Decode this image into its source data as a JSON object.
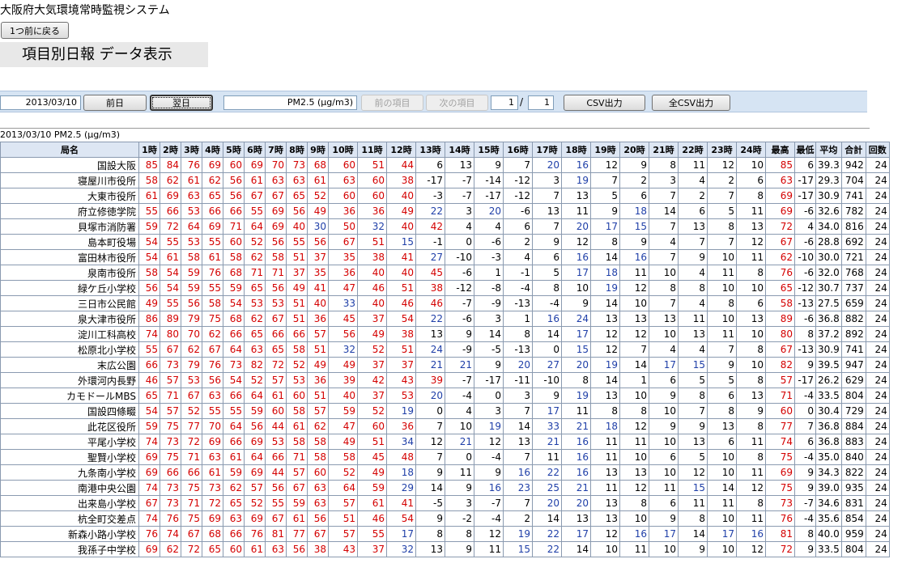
{
  "system_title": "大阪府大気環境常時監視システム",
  "back_button": "1つ前に戻る",
  "page_heading": "項目別日報 データ表示",
  "toolbar": {
    "date": "2013/03/10",
    "prev_day": "前日",
    "next_day": "翌日",
    "item": "PM2.5 (μg/m3)",
    "prev_item": "前の項目",
    "next_item": "次の項目",
    "page_current": "1",
    "page_sep": "/",
    "page_total": "1",
    "csv": "CSV出力",
    "csv_all": "全CSV出力"
  },
  "table": {
    "caption": "2013/03/10  PM2.5 (μg/m3)",
    "headers": [
      "局名",
      "1時",
      "2時",
      "3時",
      "4時",
      "5時",
      "6時",
      "7時",
      "8時",
      "9時",
      "10時",
      "11時",
      "12時",
      "13時",
      "14時",
      "15時",
      "16時",
      "17時",
      "18時",
      "19時",
      "20時",
      "21時",
      "22時",
      "23時",
      "24時",
      "最高",
      "最低",
      "平均",
      "合計",
      "回数"
    ],
    "rows": [
      [
        "国設大阪",
        "85",
        "84",
        "76",
        "69",
        "60",
        "69",
        "70",
        "73",
        "68",
        "60",
        "51",
        "44",
        "6",
        "13",
        "9",
        "7",
        "20",
        "16",
        "12",
        "9",
        "8",
        "11",
        "12",
        "10",
        "85",
        "6",
        "39.3",
        "942",
        "24"
      ],
      [
        "寝屋川市役所",
        "58",
        "62",
        "61",
        "62",
        "56",
        "61",
        "63",
        "63",
        "61",
        "63",
        "60",
        "38",
        "-17",
        "-7",
        "-14",
        "-12",
        "3",
        "19",
        "7",
        "2",
        "3",
        "4",
        "2",
        "6",
        "63",
        "-17",
        "29.3",
        "704",
        "24"
      ],
      [
        "大東市役所",
        "61",
        "69",
        "63",
        "65",
        "56",
        "67",
        "67",
        "65",
        "52",
        "60",
        "60",
        "40",
        "-3",
        "-7",
        "-17",
        "-12",
        "7",
        "13",
        "5",
        "6",
        "7",
        "2",
        "7",
        "8",
        "69",
        "-17",
        "30.9",
        "741",
        "24"
      ],
      [
        "府立修徳学院",
        "55",
        "66",
        "53",
        "66",
        "66",
        "55",
        "69",
        "56",
        "49",
        "36",
        "36",
        "49",
        "22",
        "3",
        "20",
        "-6",
        "13",
        "11",
        "9",
        "18",
        "14",
        "6",
        "5",
        "11",
        "69",
        "-6",
        "32.6",
        "782",
        "24"
      ],
      [
        "貝塚市消防署",
        "59",
        "72",
        "64",
        "69",
        "71",
        "64",
        "69",
        "40",
        "30",
        "50",
        "32",
        "40",
        "42",
        "4",
        "4",
        "6",
        "7",
        "20",
        "17",
        "15",
        "7",
        "13",
        "8",
        "13",
        "72",
        "4",
        "34.0",
        "816",
        "24"
      ],
      [
        "島本町役場",
        "54",
        "55",
        "53",
        "55",
        "60",
        "52",
        "56",
        "55",
        "56",
        "67",
        "51",
        "15",
        "-1",
        "0",
        "-6",
        "2",
        "9",
        "12",
        "8",
        "9",
        "4",
        "7",
        "7",
        "12",
        "67",
        "-6",
        "28.8",
        "692",
        "24"
      ],
      [
        "富田林市役所",
        "54",
        "61",
        "58",
        "61",
        "58",
        "62",
        "58",
        "51",
        "37",
        "35",
        "38",
        "41",
        "27",
        "-10",
        "-3",
        "4",
        "6",
        "16",
        "14",
        "16",
        "7",
        "9",
        "10",
        "11",
        "62",
        "-10",
        "30.0",
        "721",
        "24"
      ],
      [
        "泉南市役所",
        "58",
        "54",
        "59",
        "76",
        "68",
        "71",
        "71",
        "37",
        "35",
        "36",
        "40",
        "40",
        "45",
        "-6",
        "1",
        "-1",
        "5",
        "17",
        "18",
        "11",
        "10",
        "4",
        "11",
        "8",
        "76",
        "-6",
        "32.0",
        "768",
        "24"
      ],
      [
        "緑ケ丘小学校",
        "56",
        "54",
        "59",
        "55",
        "59",
        "65",
        "56",
        "49",
        "41",
        "47",
        "46",
        "51",
        "38",
        "-12",
        "-8",
        "-4",
        "8",
        "10",
        "19",
        "12",
        "8",
        "8",
        "10",
        "10",
        "65",
        "-12",
        "30.7",
        "737",
        "24"
      ],
      [
        "三日市公民館",
        "49",
        "55",
        "56",
        "58",
        "54",
        "53",
        "53",
        "51",
        "40",
        "33",
        "40",
        "46",
        "46",
        "-7",
        "-9",
        "-13",
        "-4",
        "9",
        "14",
        "10",
        "7",
        "4",
        "8",
        "6",
        "58",
        "-13",
        "27.5",
        "659",
        "24"
      ],
      [
        "泉大津市役所",
        "86",
        "89",
        "79",
        "75",
        "68",
        "62",
        "67",
        "51",
        "36",
        "45",
        "37",
        "54",
        "22",
        "-6",
        "3",
        "1",
        "16",
        "24",
        "13",
        "13",
        "13",
        "11",
        "10",
        "13",
        "89",
        "-6",
        "36.8",
        "882",
        "24"
      ],
      [
        "淀川工科高校",
        "74",
        "80",
        "70",
        "62",
        "66",
        "65",
        "66",
        "66",
        "57",
        "56",
        "49",
        "38",
        "13",
        "9",
        "14",
        "8",
        "14",
        "17",
        "12",
        "12",
        "10",
        "13",
        "11",
        "10",
        "80",
        "8",
        "37.2",
        "892",
        "24"
      ],
      [
        "松原北小学校",
        "55",
        "67",
        "62",
        "67",
        "64",
        "63",
        "65",
        "58",
        "51",
        "32",
        "52",
        "51",
        "24",
        "-9",
        "-5",
        "-13",
        "0",
        "15",
        "12",
        "7",
        "4",
        "4",
        "7",
        "8",
        "67",
        "-13",
        "30.9",
        "741",
        "24"
      ],
      [
        "末広公園",
        "66",
        "73",
        "79",
        "76",
        "73",
        "82",
        "72",
        "52",
        "49",
        "49",
        "37",
        "37",
        "21",
        "21",
        "9",
        "20",
        "27",
        "20",
        "19",
        "14",
        "17",
        "15",
        "9",
        "10",
        "82",
        "9",
        "39.5",
        "947",
        "24"
      ],
      [
        "外環河内長野",
        "46",
        "57",
        "53",
        "56",
        "54",
        "52",
        "57",
        "53",
        "36",
        "39",
        "42",
        "43",
        "39",
        "-7",
        "-17",
        "-11",
        "-10",
        "8",
        "14",
        "1",
        "6",
        "5",
        "5",
        "8",
        "57",
        "-17",
        "26.2",
        "629",
        "24"
      ],
      [
        "カモドールMBS",
        "65",
        "71",
        "67",
        "63",
        "66",
        "64",
        "61",
        "60",
        "51",
        "40",
        "37",
        "53",
        "20",
        "-4",
        "0",
        "3",
        "9",
        "19",
        "13",
        "10",
        "9",
        "8",
        "6",
        "13",
        "71",
        "-4",
        "33.5",
        "804",
        "24"
      ],
      [
        "国設四條畷",
        "54",
        "57",
        "52",
        "55",
        "55",
        "59",
        "60",
        "58",
        "57",
        "59",
        "52",
        "19",
        "0",
        "4",
        "3",
        "7",
        "17",
        "11",
        "8",
        "8",
        "10",
        "7",
        "8",
        "9",
        "60",
        "0",
        "30.4",
        "729",
        "24"
      ],
      [
        "此花区役所",
        "59",
        "75",
        "77",
        "70",
        "64",
        "56",
        "44",
        "61",
        "62",
        "47",
        "60",
        "36",
        "7",
        "10",
        "19",
        "14",
        "33",
        "21",
        "18",
        "12",
        "9",
        "9",
        "13",
        "8",
        "77",
        "7",
        "36.8",
        "884",
        "24"
      ],
      [
        "平尾小学校",
        "74",
        "73",
        "72",
        "69",
        "66",
        "69",
        "53",
        "58",
        "58",
        "49",
        "51",
        "34",
        "12",
        "21",
        "12",
        "13",
        "21",
        "16",
        "11",
        "11",
        "10",
        "13",
        "6",
        "11",
        "74",
        "6",
        "36.8",
        "883",
        "24"
      ],
      [
        "聖賢小学校",
        "69",
        "75",
        "71",
        "63",
        "61",
        "64",
        "66",
        "71",
        "58",
        "58",
        "45",
        "48",
        "7",
        "0",
        "-4",
        "7",
        "11",
        "16",
        "11",
        "10",
        "6",
        "5",
        "10",
        "8",
        "75",
        "-4",
        "35.0",
        "840",
        "24"
      ],
      [
        "九条南小学校",
        "69",
        "66",
        "66",
        "61",
        "59",
        "69",
        "44",
        "57",
        "60",
        "52",
        "49",
        "18",
        "9",
        "11",
        "9",
        "16",
        "22",
        "16",
        "13",
        "13",
        "10",
        "12",
        "10",
        "11",
        "69",
        "9",
        "34.3",
        "822",
        "24"
      ],
      [
        "南港中央公園",
        "74",
        "73",
        "75",
        "73",
        "62",
        "57",
        "56",
        "67",
        "63",
        "64",
        "59",
        "29",
        "14",
        "9",
        "16",
        "23",
        "25",
        "21",
        "11",
        "12",
        "11",
        "15",
        "14",
        "12",
        "75",
        "9",
        "39.0",
        "935",
        "24"
      ],
      [
        "出来島小学校",
        "67",
        "73",
        "71",
        "72",
        "65",
        "52",
        "55",
        "59",
        "63",
        "57",
        "61",
        "41",
        "-5",
        "3",
        "-7",
        "7",
        "20",
        "20",
        "13",
        "8",
        "6",
        "11",
        "11",
        "8",
        "73",
        "-7",
        "34.6",
        "831",
        "24"
      ],
      [
        "杭全町交差点",
        "74",
        "76",
        "75",
        "69",
        "63",
        "69",
        "67",
        "61",
        "56",
        "51",
        "46",
        "54",
        "9",
        "-2",
        "-4",
        "2",
        "14",
        "13",
        "13",
        "10",
        "9",
        "8",
        "10",
        "11",
        "76",
        "-4",
        "35.6",
        "854",
        "24"
      ],
      [
        "新森小路小学校",
        "76",
        "74",
        "67",
        "68",
        "66",
        "76",
        "81",
        "77",
        "67",
        "57",
        "55",
        "17",
        "8",
        "8",
        "12",
        "19",
        "22",
        "17",
        "12",
        "16",
        "17",
        "14",
        "17",
        "16",
        "81",
        "8",
        "40.0",
        "959",
        "24"
      ],
      [
        "我孫子中学校",
        "69",
        "62",
        "72",
        "65",
        "60",
        "61",
        "63",
        "56",
        "38",
        "43",
        "37",
        "32",
        "13",
        "9",
        "11",
        "15",
        "22",
        "14",
        "10",
        "11",
        "10",
        "9",
        "10",
        "12",
        "72",
        "9",
        "33.5",
        "804",
        "24"
      ]
    ]
  }
}
